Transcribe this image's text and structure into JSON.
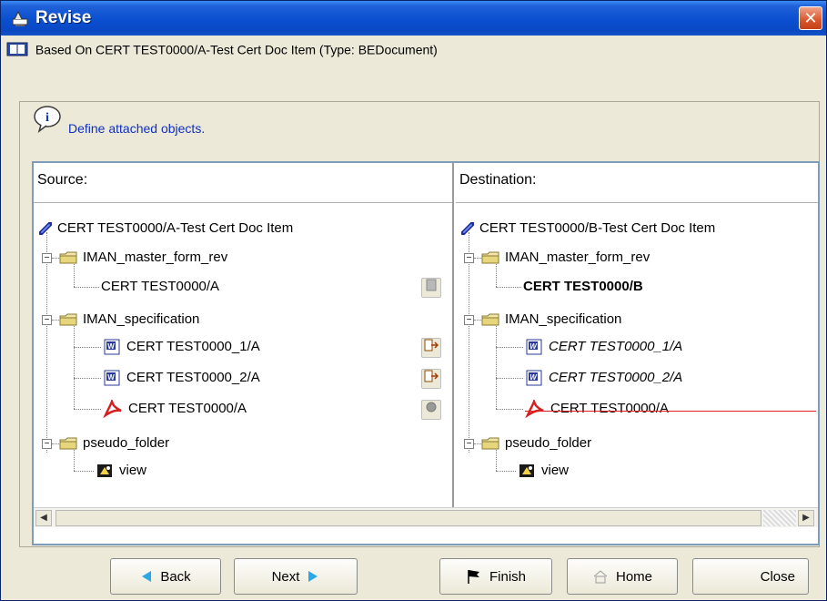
{
  "window": {
    "title": "Revise",
    "close_label": "✕"
  },
  "based_on": "Based On CERT TEST0000/A-Test Cert Doc Item (Type: BEDocument)",
  "info": {
    "text": "Define attached objects."
  },
  "source": {
    "header": "Source:",
    "root": "CERT TEST0000/A-Test Cert Doc Item",
    "folders": [
      {
        "label": "IMAN_master_form_rev",
        "children": [
          "CERT TEST0000/A"
        ]
      },
      {
        "label": "IMAN_specification",
        "children": [
          "CERT TEST0000_1/A",
          "CERT TEST0000_2/A",
          "CERT TEST0000/A"
        ]
      },
      {
        "label": "pseudo_folder",
        "children": [
          "view"
        ]
      }
    ]
  },
  "destination": {
    "header": "Destination:",
    "root": "CERT TEST0000/B-Test Cert Doc Item",
    "folders": [
      {
        "label": "IMAN_master_form_rev",
        "children": [
          "CERT TEST0000/B"
        ]
      },
      {
        "label": "IMAN_specification",
        "children": [
          "CERT TEST0000_1/A",
          "CERT TEST0000_2/A",
          "CERT TEST0000/A"
        ]
      },
      {
        "label": "pseudo_folder",
        "children": [
          "view"
        ]
      }
    ]
  },
  "buttons": {
    "back": "Back",
    "next": "Next",
    "finish": "Finish",
    "home": "Home",
    "close": "Close"
  },
  "colors": {
    "titlebar": "#0a4fd0",
    "info_text": "#1030c0",
    "strike_line": "#e02020"
  }
}
